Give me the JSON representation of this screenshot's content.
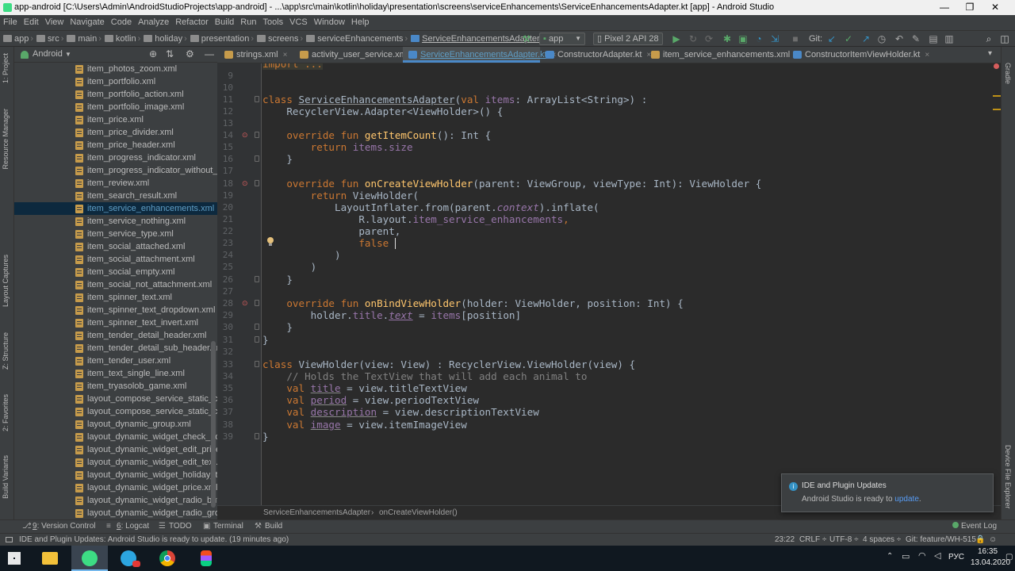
{
  "window": {
    "title": "app-android [C:\\Users\\Admin\\AndroidStudioProjects\\app-android] - ...\\app\\src\\main\\kotlin\\holiday\\presentation\\screens\\serviceEnhancements\\ServiceEnhancementsAdapter.kt [app] - Android Studio",
    "minimize": "—",
    "maximize": "❐",
    "close": "✕"
  },
  "menu": [
    "File",
    "Edit",
    "View",
    "Navigate",
    "Code",
    "Analyze",
    "Refactor",
    "Build",
    "Run",
    "Tools",
    "VCS",
    "Window",
    "Help"
  ],
  "breadcrumb": [
    "app",
    "src",
    "main",
    "kotlin",
    "holiday",
    "presentation",
    "screens",
    "serviceEnhancements",
    "ServiceEnhancementsAdapter.kt"
  ],
  "toolbar": {
    "run_config": "app",
    "device": "Pixel 2 API 28",
    "git_label": "Git:"
  },
  "project_panel": {
    "view": "Android",
    "files": [
      "item_photos_zoom.xml",
      "item_portfolio.xml",
      "item_portfolio_action.xml",
      "item_portfolio_image.xml",
      "item_price.xml",
      "item_price_divider.xml",
      "item_price_header.xml",
      "item_progress_indicator.xml",
      "item_progress_indicator_without_padding.x",
      "item_review.xml",
      "item_search_result.xml",
      "item_service_enhancements.xml",
      "item_service_nothing.xml",
      "item_service_type.xml",
      "item_social_attached.xml",
      "item_social_attachment.xml",
      "item_social_empty.xml",
      "item_social_not_attachment.xml",
      "item_spinner_text.xml",
      "item_spinner_text_dropdown.xml",
      "item_spinner_text_invert.xml",
      "item_tender_detail_header.xml",
      "item_tender_detail_sub_header.xml",
      "item_tender_user.xml",
      "item_text_single_line.xml",
      "item_tryasolob_game.xml",
      "layout_compose_service_static_content_bo",
      "layout_compose_service_static_content_top",
      "layout_dynamic_group.xml",
      "layout_dynamic_widget_check_box.xml",
      "layout_dynamic_widget_edit_price.xml",
      "layout_dynamic_widget_edit_text.xml",
      "layout_dynamic_widget_holiday_type.xml",
      "layout_dynamic_widget_price.xml",
      "layout_dynamic_widget_radio_button.xml",
      "layout_dynamic_widget_radio_group.xml"
    ],
    "selected_index": 11
  },
  "left_strip": [
    "1: Project",
    "Resource Manager",
    "Layout Captures",
    "Z: Structure",
    "2: Favorites",
    "Build Variants"
  ],
  "right_strip": [
    "Gradle",
    "Device File Explorer"
  ],
  "tabs": [
    {
      "label": "strings.xml",
      "color": "#c69b4b"
    },
    {
      "label": "activity_user_service.xml",
      "color": "#c69b4b"
    },
    {
      "label": "ServiceEnhancementsAdapter.kt",
      "color": "#4a88c7",
      "active": true
    },
    {
      "label": "ConstructorAdapter.kt",
      "color": "#4a88c7"
    },
    {
      "label": "item_service_enhancements.xml",
      "color": "#c69b4b"
    },
    {
      "label": "ConstructorItemViewHolder.kt",
      "color": "#4a88c7"
    }
  ],
  "tab_close": "×",
  "code": {
    "line_numbers": [
      "9",
      "10",
      "11",
      "12",
      "13",
      "14",
      "15",
      "16",
      "17",
      "18",
      "19",
      "20",
      "21",
      "22",
      "23",
      "24",
      "25",
      "26",
      "27",
      "28",
      "29",
      "30",
      "31",
      "32",
      "33",
      "34",
      "35",
      "36",
      "37",
      "38",
      "39"
    ],
    "import": "import ...",
    "l11": [
      "class ",
      "ServiceEnhancementsAdapter",
      "(",
      "val ",
      "items",
      ": ArrayList<String>) :"
    ],
    "l12": "    RecyclerView.Adapter<ViewHolder>() {",
    "l14": [
      "    override fun ",
      "getItemCount",
      "(): Int {"
    ],
    "l15": [
      "        return ",
      "items",
      ".size"
    ],
    "l16": "    }",
    "l18": [
      "    override fun ",
      "onCreateViewHolder",
      "(parent: ViewGroup, viewType: Int): ViewHolder {"
    ],
    "l19": [
      "        return ",
      "ViewHolder("
    ],
    "l20": [
      "            LayoutInflater.from(parent.",
      "context",
      ").inflate("
    ],
    "l21": [
      "                R.layout.",
      "item_service_enhancements",
      ","
    ],
    "l22": "                parent,",
    "l23": [
      "                ",
      "false"
    ],
    "l24": "            )",
    "l25": "        )",
    "l26": "    }",
    "l28": [
      "    override fun ",
      "onBindViewHolder",
      "(holder: ViewHolder, position: Int) {"
    ],
    "l29": [
      "        holder.",
      "title",
      ".",
      "text",
      " = ",
      "items",
      "[position]"
    ],
    "l30": "    }",
    "l31": "}",
    "l33": [
      "class ",
      "ViewHolder",
      "(view: View) : RecyclerView.ViewHolder(view) {"
    ],
    "l34": "    // Holds the TextView that will add each animal to",
    "l35": [
      "    val ",
      "title",
      " = view.titleTextView"
    ],
    "l36": [
      "    val ",
      "period",
      " = view.periodTextView"
    ],
    "l37": [
      "    val ",
      "description",
      " = view.descriptionTextView"
    ],
    "l38": [
      "    val ",
      "image",
      " = view.itemImageView"
    ],
    "l39": "}"
  },
  "editor_breadcrumb": [
    "ServiceEnhancementsAdapter",
    "onCreateViewHolder()"
  ],
  "tool_windows": [
    {
      "key": "9",
      "label": ": Version Control",
      "icon": "⎇"
    },
    {
      "key": "6",
      "label": ": Logcat",
      "icon": "≡"
    },
    {
      "key": "",
      "label": "TODO",
      "icon": "☰"
    },
    {
      "key": "",
      "label": "Terminal",
      "icon": "▣"
    },
    {
      "key": "",
      "label": "Build",
      "icon": "⚒"
    }
  ],
  "event_log": "Event Log",
  "status": {
    "message": "IDE and Plugin Updates: Android Studio is ready to update. (19 minutes ago)",
    "position": "23:22",
    "line_sep": "CRLF ÷",
    "encoding": "UTF-8 ÷",
    "indent": "4 spaces ÷",
    "git": "Git: feature/WH-515 ÷"
  },
  "notification": {
    "title": "IDE and Plugin Updates",
    "body": "Android Studio is ready to ",
    "link": "update",
    "dot": "."
  },
  "taskbar": {
    "lang": "РУС",
    "time": "16:35",
    "date": "13.04.2020"
  }
}
